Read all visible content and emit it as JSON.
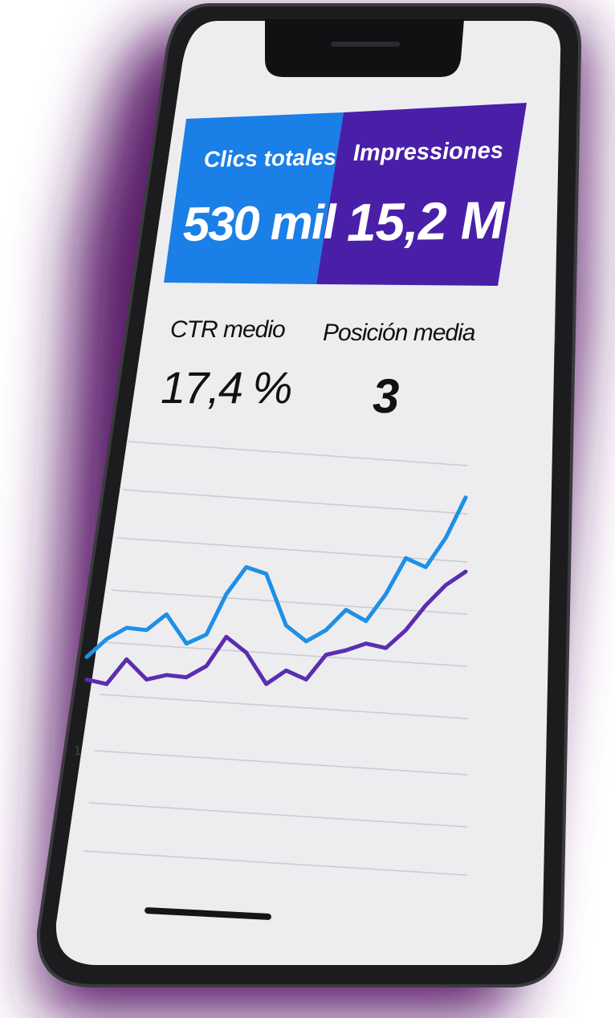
{
  "colors": {
    "background_glow": "#5b1f6b",
    "phone_frame": "#1c1c1e",
    "screen_bg": "#ededf0",
    "clicks_tile": "#1a7fe6",
    "impressions_tile": "#4a1fa8",
    "clicks_line": "#1e90e6",
    "impressions_line": "#5b2db0",
    "grid_line": "#c9cacf",
    "text_dark": "#111111",
    "text_light": "#ffffff"
  },
  "metrics": {
    "clicks": {
      "label": "Clics totales",
      "value": "530 mil"
    },
    "impressions": {
      "label": "Impressiones",
      "value": "15,2 M"
    }
  },
  "stats": {
    "ctr": {
      "label": "CTR medio",
      "value": "17,4 %"
    },
    "position": {
      "label": "Posición media",
      "value": "3"
    }
  },
  "axis": {
    "tick_label": "1"
  },
  "chart_data": {
    "type": "line",
    "title": "",
    "xlabel": "",
    "ylabel": "",
    "x": [
      1,
      2,
      3,
      4,
      5,
      6,
      7,
      8,
      9,
      10,
      11,
      12,
      13,
      14,
      15,
      16,
      17,
      18,
      19,
      20
    ],
    "series": [
      {
        "values": [
          2.2,
          3.0,
          3.5,
          3.4,
          4.1,
          2.8,
          3.2,
          5.0,
          6.2,
          5.9,
          3.6,
          2.9,
          3.4,
          4.3,
          3.8,
          5.0,
          6.6,
          6.2,
          7.5,
          9.3
        ]
      },
      {
        "values": [
          1.2,
          1.0,
          2.1,
          1.2,
          1.4,
          1.3,
          1.8,
          3.1,
          2.4,
          1.0,
          1.6,
          1.2,
          2.3,
          2.5,
          2.8,
          2.6,
          3.4,
          4.5,
          5.4,
          6.0
        ]
      }
    ],
    "ylim": [
      0,
      10
    ],
    "grid": true
  }
}
